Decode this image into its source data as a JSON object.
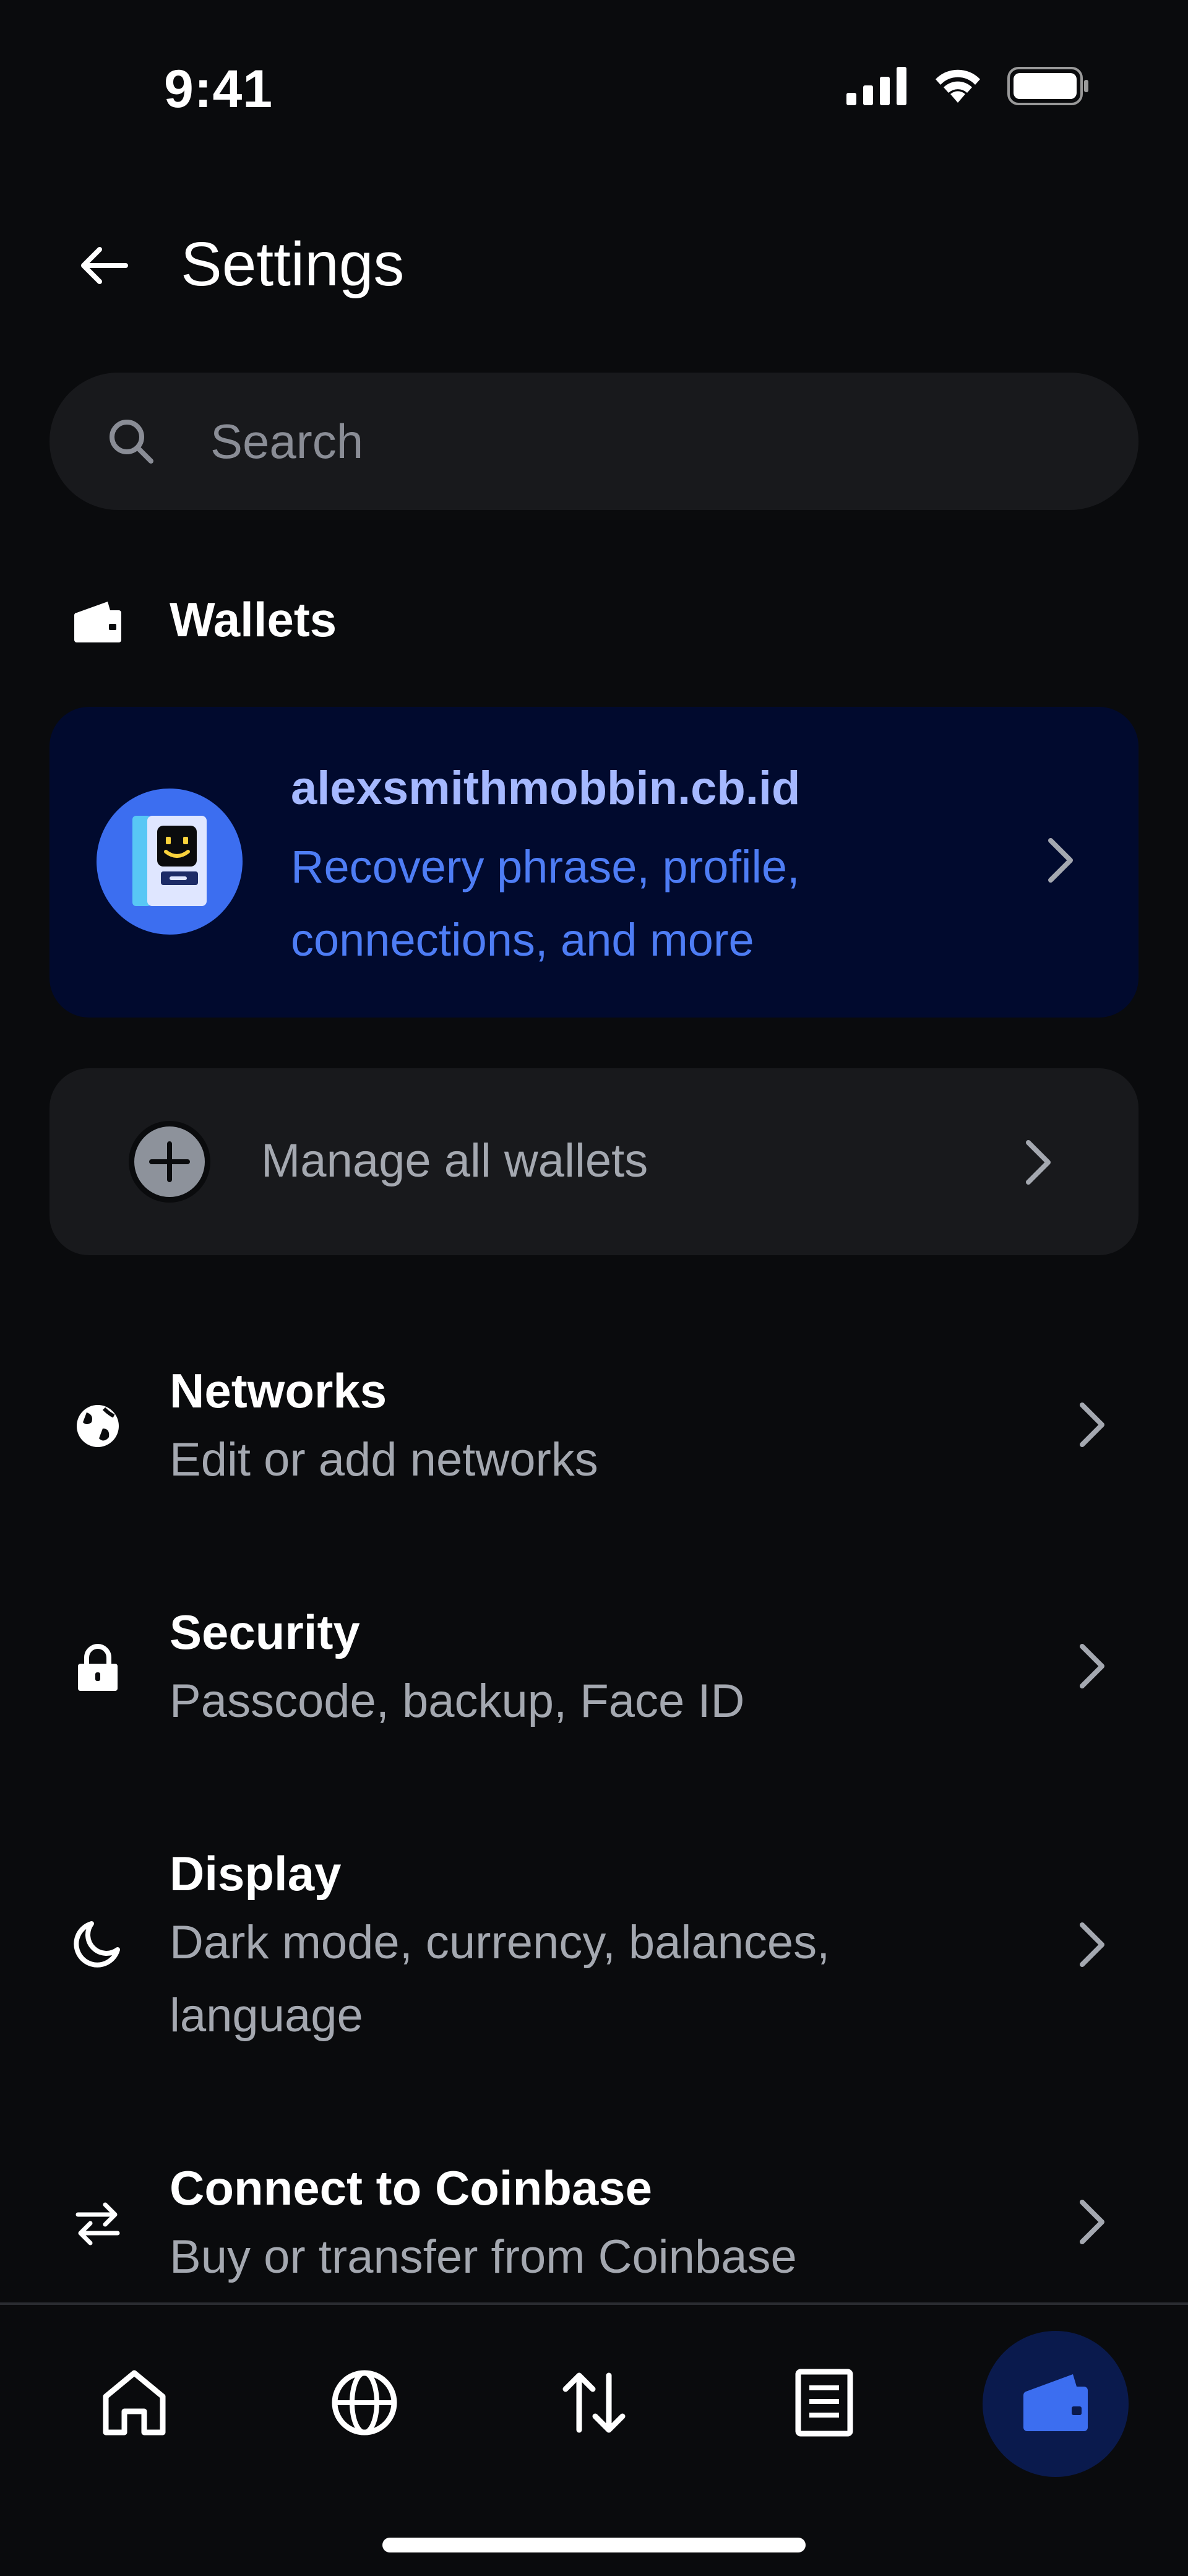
{
  "status_bar": {
    "time": "9:41"
  },
  "header": {
    "title": "Settings"
  },
  "search": {
    "placeholder": "Search"
  },
  "wallets_section": {
    "label": "Wallets"
  },
  "wallet_card": {
    "name": "alexsmithmobbin.cb.id",
    "subtitle": "Recovery phrase, profile, connections, and more"
  },
  "manage_wallets": {
    "label": "Manage all wallets"
  },
  "settings_items": [
    {
      "title": "Networks",
      "subtitle": "Edit or add networks",
      "icon": "globe-icon"
    },
    {
      "title": "Security",
      "subtitle": "Passcode, backup, Face ID",
      "icon": "lock-icon"
    },
    {
      "title": "Display",
      "subtitle": "Dark mode, currency, balances, language",
      "icon": "moon-icon"
    },
    {
      "title": "Connect to Coinbase",
      "subtitle": "Buy or transfer from Coinbase",
      "icon": "swap-icon"
    }
  ],
  "bottom_nav": [
    {
      "name": "home",
      "icon": "home-icon",
      "active": false
    },
    {
      "name": "browser",
      "icon": "globe-icon",
      "active": false
    },
    {
      "name": "trade",
      "icon": "swap-arrows-icon",
      "active": false
    },
    {
      "name": "activity",
      "icon": "document-icon",
      "active": false
    },
    {
      "name": "wallet",
      "icon": "wallet-icon",
      "active": true
    }
  ],
  "colors": {
    "background": "#0a0b0d",
    "surface": "#18191c",
    "wallet_card_bg": "#010a2e",
    "accent_blue": "#3c6ef0",
    "wallet_name": "#a5b8ff",
    "secondary_text": "#a4a8b0"
  }
}
